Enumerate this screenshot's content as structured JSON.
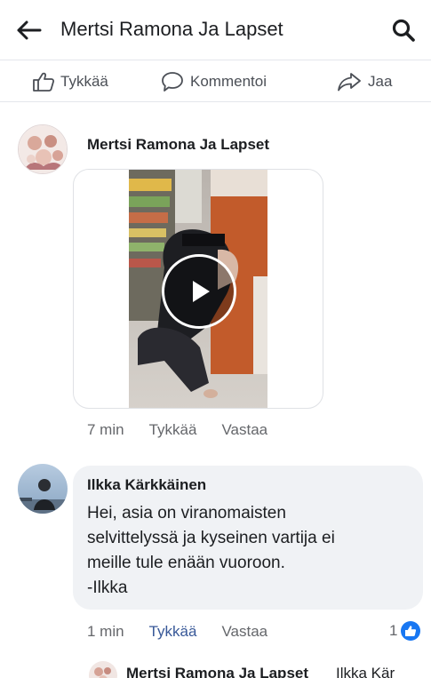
{
  "header": {
    "title": "Mertsi Ramona Ja Lapset",
    "back_icon": "back-arrow-icon",
    "search_icon": "search-icon"
  },
  "actions": {
    "like_label": "Tykkää",
    "comment_label": "Kommentoi",
    "share_label": "Jaa"
  },
  "post_comment": {
    "author": "Mertsi Ramona Ja Lapset",
    "attachment": "video",
    "time": "7 min",
    "like_label": "Tykkää",
    "reply_label": "Vastaa"
  },
  "reply_comment": {
    "author": "Ilkka Kärkkäinen",
    "text_lines": [
      "Hei, asia on viranomaisten",
      "selvittelyssä ja kyseinen vartija ei",
      "meille tule enään vuoroon.",
      "-Ilkka"
    ],
    "time": "1 min",
    "like_label": "Tykkää",
    "reply_label": "Vastaa",
    "reaction_count": "1",
    "reaction_icon": "thumbs-up-reaction-icon"
  },
  "nested_reply": {
    "author": "Mertsi Ramona Ja Lapset",
    "text": "Ilkka Kär"
  },
  "colors": {
    "link_blue": "#385898",
    "facebook_blue": "#1877f2",
    "bubble_gray": "#f0f2f5",
    "secondary_text": "#65676b"
  }
}
